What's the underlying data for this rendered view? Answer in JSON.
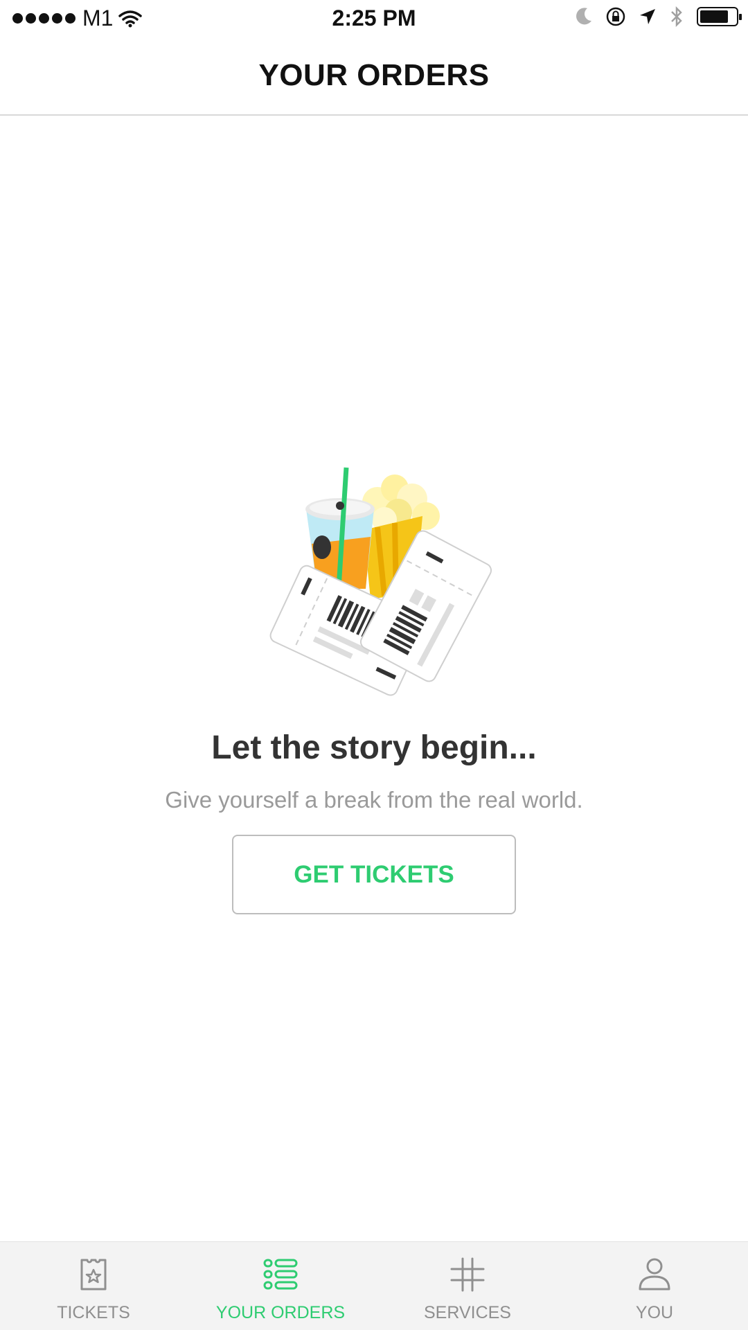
{
  "status_bar": {
    "carrier": "M1",
    "time": "2:25 PM",
    "battery_level": 0.8
  },
  "header": {
    "title": "YOUR ORDERS"
  },
  "empty_state": {
    "title": "Let the story begin...",
    "subtitle": "Give yourself a break from the real world.",
    "button_label": "GET TICKETS"
  },
  "tab_bar": {
    "tabs": [
      {
        "label": "TICKETS",
        "icon": "ticket-icon",
        "active": false
      },
      {
        "label": "YOUR ORDERS",
        "icon": "orders-list-icon",
        "active": true
      },
      {
        "label": "SERVICES",
        "icon": "grid-hash-icon",
        "active": false
      },
      {
        "label": "YOU",
        "icon": "person-icon",
        "active": false
      }
    ]
  },
  "colors": {
    "accent": "#2ecc71",
    "inactive": "#8f8f8f",
    "title": "#111111",
    "subtitle": "#9a9a9a"
  }
}
